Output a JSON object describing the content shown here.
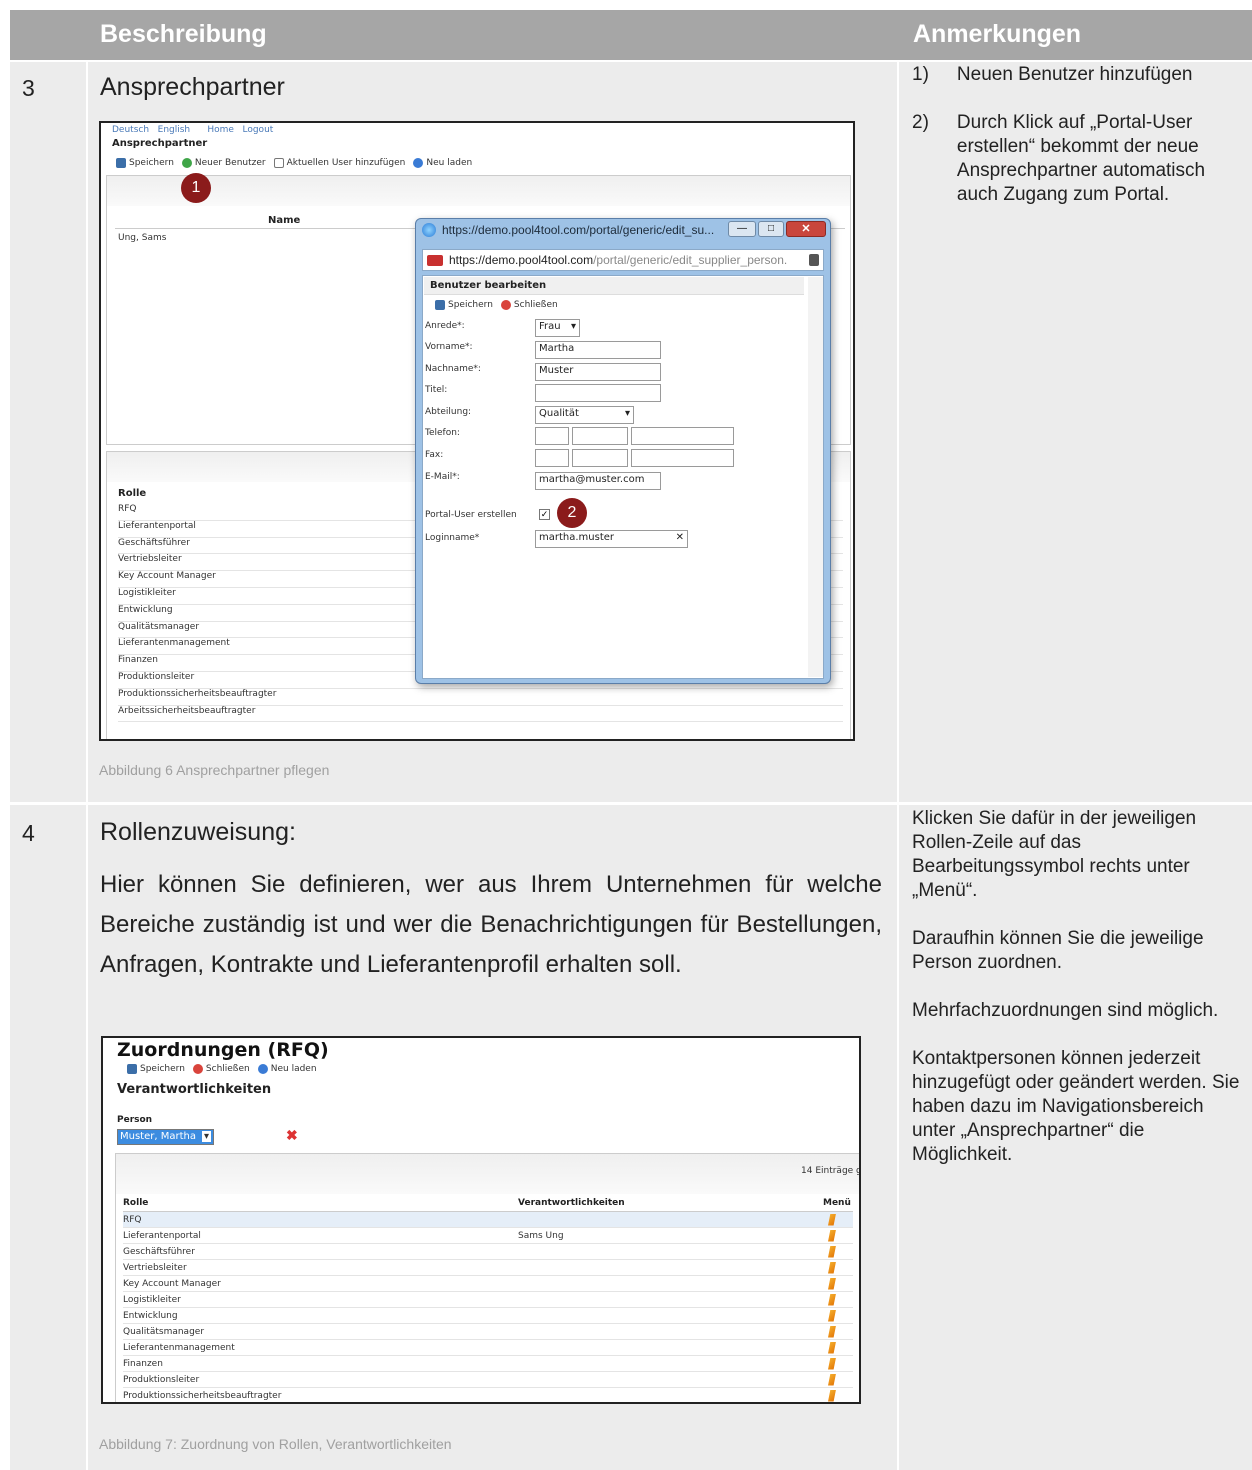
{
  "header": {
    "col1": "Beschreibung",
    "col2": "Anmerkungen"
  },
  "row3": {
    "num": "3",
    "title": "Ansprechpartner",
    "caption": "Abbildung 6 Ansprechpartner pflegen",
    "notes": [
      {
        "num": "1)",
        "text": "Neuen Benutzer hinzufügen"
      },
      {
        "num": "2)",
        "text": "Durch Klick auf „Portal-User erstellen“ bekommt der neue Ansprechpartner automatisch auch Zugang zum Portal."
      }
    ],
    "screenshot": {
      "langs": [
        "Deutsch",
        "English"
      ],
      "nav": [
        "Home",
        "Logout"
      ],
      "page_title": "Ansprechpartner",
      "toolbar": [
        "Speichern",
        "Neuer Benutzer",
        "Aktuellen User hinzufügen",
        "Neu laden"
      ],
      "badge1": "1",
      "name_header": "Name",
      "name_value": "Ung, Sams",
      "role_header": "Rolle",
      "roles": [
        "RFQ",
        "Lieferantenportal",
        "Geschäftsführer",
        "Vertriebsleiter",
        "Key Account Manager",
        "Logistikleiter",
        "Entwicklung",
        "Qualitätsmanager",
        "Lieferantenmanagement",
        "Finanzen",
        "Produktionsleiter",
        "Produktionssicherheitsbeauftragter",
        "Arbeitssicherheitsbeauftragter"
      ],
      "popup": {
        "window_title": "https://demo.pool4tool.com/portal/generic/edit_su...",
        "url_host": "https://demo.pool4tool.com",
        "url_path": "/portal/generic/edit_supplier_person.",
        "form_title": "Benutzer bearbeiten",
        "toolbar": [
          "Speichern",
          "Schließen"
        ],
        "labels": {
          "anrede": "Anrede*:",
          "vorname": "Vorname*:",
          "nachname": "Nachname*:",
          "titel": "Titel:",
          "abteilung": "Abteilung:",
          "telefon": "Telefon:",
          "fax": "Fax:",
          "email": "E-Mail*:",
          "portal_user": "Portal-User erstellen",
          "loginname": "Loginname*"
        },
        "values": {
          "anrede": "Frau",
          "vorname": "Martha",
          "nachname": "Muster",
          "abteilung": "Qualität",
          "email": "martha@muster.com",
          "loginname": "martha.muster"
        },
        "badge2": "2"
      }
    }
  },
  "row4": {
    "num": "4",
    "title": "Rollenzuweisung:",
    "paragraph": "Hier können Sie definieren, wer aus Ihrem Unternehmen für welche Bereiche zuständig ist und wer die Benachrichtigungen für Bestellungen, Anfragen, Kontrakte und Lieferantenprofil erhalten soll.",
    "caption": "Abbildung 7: Zuordnung von Rollen, Verantwortlichkeiten",
    "notes": [
      "Klicken Sie dafür in der jeweiligen Rollen-Zeile auf das Bearbeitungssymbol rechts unter „Menü“.",
      "Daraufhin können Sie die jeweilige Person zuordnen.",
      "Mehrfachzuordnungen sind möglich.",
      "Kontaktpersonen können jederzeit hinzugefügt oder geändert werden. Sie haben dazu im Navigationsbereich unter „Ansprechpartner“ die Möglichkeit."
    ],
    "screenshot": {
      "title": "Zuordnungen (RFQ)",
      "toolbar": [
        "Speichern",
        "Schließen",
        "Neu laden"
      ],
      "section": "Verantwortlichkeiten",
      "person_label": "Person",
      "person_value": "Muster, Martha",
      "count": "14 Einträge g",
      "headers": [
        "Rolle",
        "Verantwortlichkeiten",
        "Menü"
      ],
      "rows": [
        {
          "rolle": "RFQ",
          "verantw": ""
        },
        {
          "rolle": "Lieferantenportal",
          "verantw": "Sams Ung"
        },
        {
          "rolle": "Geschäftsführer",
          "verantw": ""
        },
        {
          "rolle": "Vertriebsleiter",
          "verantw": ""
        },
        {
          "rolle": "Key Account Manager",
          "verantw": ""
        },
        {
          "rolle": "Logistikleiter",
          "verantw": ""
        },
        {
          "rolle": "Entwicklung",
          "verantw": ""
        },
        {
          "rolle": "Qualitätsmanager",
          "verantw": ""
        },
        {
          "rolle": "Lieferantenmanagement",
          "verantw": ""
        },
        {
          "rolle": "Finanzen",
          "verantw": ""
        },
        {
          "rolle": "Produktionsleiter",
          "verantw": ""
        },
        {
          "rolle": "Produktionssicherheitsbeauftragter",
          "verantw": ""
        }
      ]
    }
  }
}
